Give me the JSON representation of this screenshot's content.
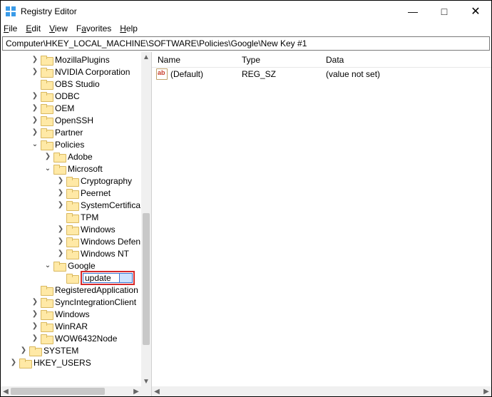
{
  "window": {
    "title": "Registry Editor"
  },
  "menu": {
    "file": "File",
    "edit": "Edit",
    "view": "View",
    "favorites": "Favorites",
    "help": "Help"
  },
  "address": "Computer\\HKEY_LOCAL_MACHINE\\SOFTWARE\\Policies\\Google\\New Key #1",
  "tree": {
    "mozillaPlugins": "MozillaPlugins",
    "nvidia": "NVIDIA Corporation",
    "obs": "OBS Studio",
    "odbc": "ODBC",
    "oem": "OEM",
    "openssh": "OpenSSH",
    "partner": "Partner",
    "policies": "Policies",
    "adobe": "Adobe",
    "microsoft": "Microsoft",
    "cryptography": "Cryptography",
    "peernet": "Peernet",
    "systemCert": "SystemCertifica",
    "tpm": "TPM",
    "windows1": "Windows",
    "windowsDef": "Windows Defen",
    "windowsNt": "Windows NT",
    "google": "Google",
    "updateEdit": "update",
    "regApps": "RegisteredApplication",
    "syncClients": "SyncIntegrationClient",
    "windows2": "Windows",
    "winrar": "WinRAR",
    "wow64": "WOW6432Node",
    "system": "SYSTEM",
    "hkeyUsers": "HKEY_USERS"
  },
  "list": {
    "headers": {
      "name": "Name",
      "type": "Type",
      "data": "Data"
    },
    "rows": [
      {
        "name": "(Default)",
        "type": "REG_SZ",
        "data": "(value not set)"
      }
    ]
  }
}
